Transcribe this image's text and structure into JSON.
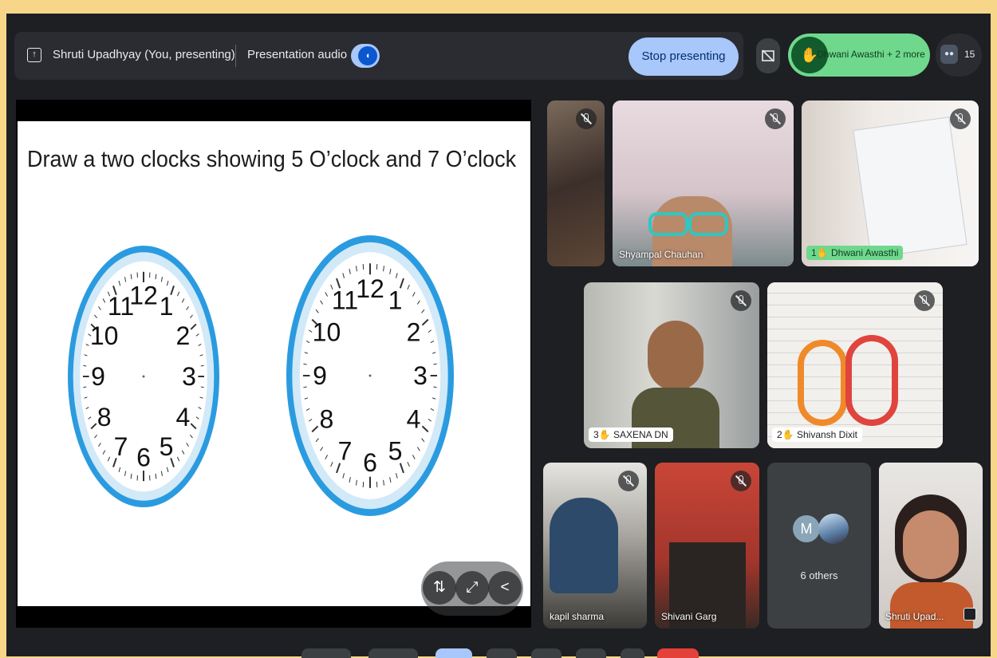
{
  "meeting": {
    "presenter_label": "Shruti Upadhyay (You, presenting)",
    "audio_label": "Presentation audio",
    "stop_button": "Stop presenting",
    "raised_hands": "Dhwani Awasthi + 2 more",
    "participant_count": "15",
    "presentation_audio_on": true
  },
  "slide": {
    "title": "Draw a two clocks showing 5 O’clock and 7 O’clock",
    "clock_numbers": [
      "12",
      "1",
      "2",
      "3",
      "4",
      "5",
      "6",
      "7",
      "8",
      "9",
      "10",
      "11"
    ]
  },
  "tiles": [
    {
      "name": "",
      "muted": true
    },
    {
      "name": "Shyampal Chauhan",
      "muted": true
    },
    {
      "name": "Dhwani Awasthi",
      "hand_rank": "1",
      "muted": true
    },
    {
      "name": "SAXENA DN",
      "hand_rank": "3",
      "muted": true
    },
    {
      "name": "Shivansh Dixit",
      "hand_rank": "2",
      "muted": true
    },
    {
      "name": "kapil sharma",
      "muted": true
    },
    {
      "name": "Shivani Garg",
      "muted": true
    },
    {
      "name": "6 others",
      "avatar_letter": "M"
    },
    {
      "name": "Shruti Upad...",
      "self": true
    }
  ],
  "colors": {
    "accent": "#a8c7fa",
    "raise_hand": "#6fd88d",
    "clock_rim": "#2b9be0",
    "page_border": "#f7d68a"
  }
}
